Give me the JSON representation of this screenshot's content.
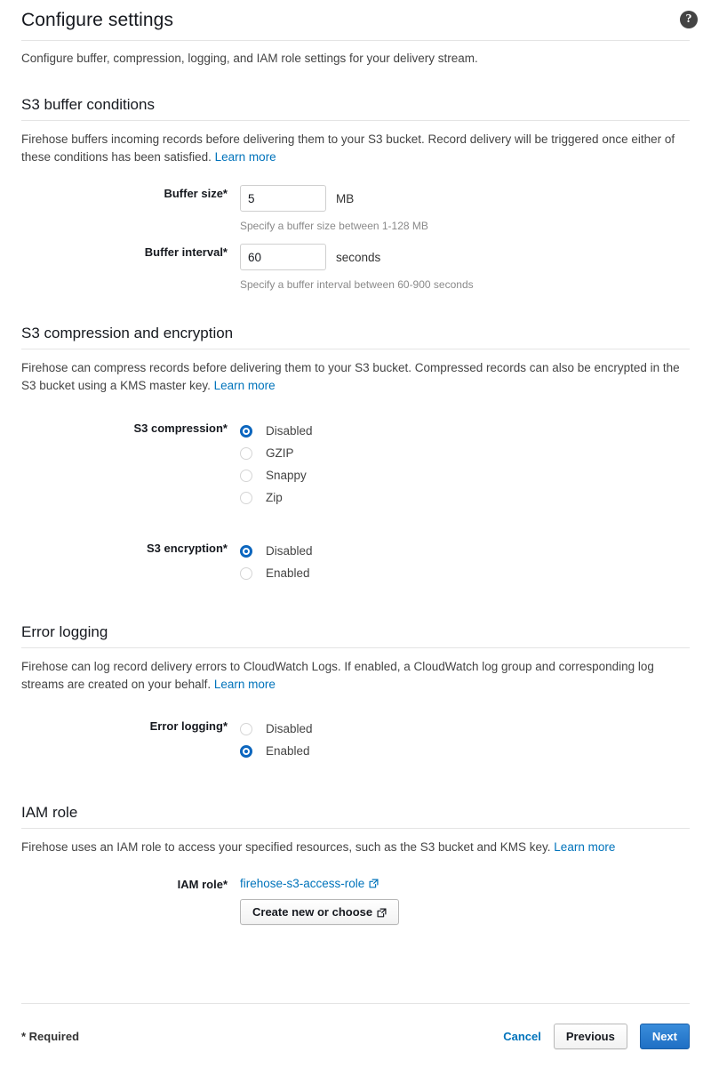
{
  "header": {
    "title": "Configure settings",
    "help_icon": "help-icon",
    "intro": "Configure buffer, compression, logging, and IAM role settings for your delivery stream."
  },
  "sections": {
    "buffer": {
      "heading": "S3 buffer conditions",
      "description_before_link": "Firehose buffers incoming records before delivering them to your S3 bucket. Record delivery will be triggered once either of these conditions has been satisfied. ",
      "learn_more": "Learn more",
      "buffer_size": {
        "label": "Buffer size*",
        "value": "5",
        "unit": "MB",
        "hint": "Specify a buffer size between 1-128 MB"
      },
      "buffer_interval": {
        "label": "Buffer interval*",
        "value": "60",
        "unit": "seconds",
        "hint": "Specify a buffer interval between 60-900 seconds"
      }
    },
    "compression": {
      "heading": "S3 compression and encryption",
      "description_before_link": "Firehose can compress records before delivering them to your S3 bucket. Compressed records can also be encrypted in the S3 bucket using a KMS master key. ",
      "learn_more": "Learn more",
      "s3_compression": {
        "label": "S3 compression*",
        "options": [
          {
            "label": "Disabled",
            "selected": true
          },
          {
            "label": "GZIP",
            "selected": false
          },
          {
            "label": "Snappy",
            "selected": false
          },
          {
            "label": "Zip",
            "selected": false
          }
        ]
      },
      "s3_encryption": {
        "label": "S3 encryption*",
        "options": [
          {
            "label": "Disabled",
            "selected": true
          },
          {
            "label": "Enabled",
            "selected": false
          }
        ]
      }
    },
    "error_logging": {
      "heading": "Error logging",
      "description_before_link": "Firehose can log record delivery errors to CloudWatch Logs. If enabled, a CloudWatch log group and corresponding log streams are created on your behalf. ",
      "learn_more": "Learn more",
      "field": {
        "label": "Error logging*",
        "options": [
          {
            "label": "Disabled",
            "selected": false
          },
          {
            "label": "Enabled",
            "selected": true
          }
        ]
      }
    },
    "iam_role": {
      "heading": "IAM role",
      "description_before_link": "Firehose uses an IAM role to access your specified resources, such as the S3 bucket and KMS key. ",
      "learn_more": "Learn more",
      "field": {
        "label": "IAM role*",
        "role_link": "firehose-s3-access-role",
        "button": "Create new or choose"
      }
    }
  },
  "footer": {
    "required_note": "* Required",
    "cancel": "Cancel",
    "previous": "Previous",
    "next": "Next"
  },
  "colors": {
    "link": "#0073bb",
    "primary_button": "#1f6fc4",
    "radio_selected": "#0d68c2",
    "divider": "#e4e4e4",
    "hint_text": "#8a8a8a"
  }
}
